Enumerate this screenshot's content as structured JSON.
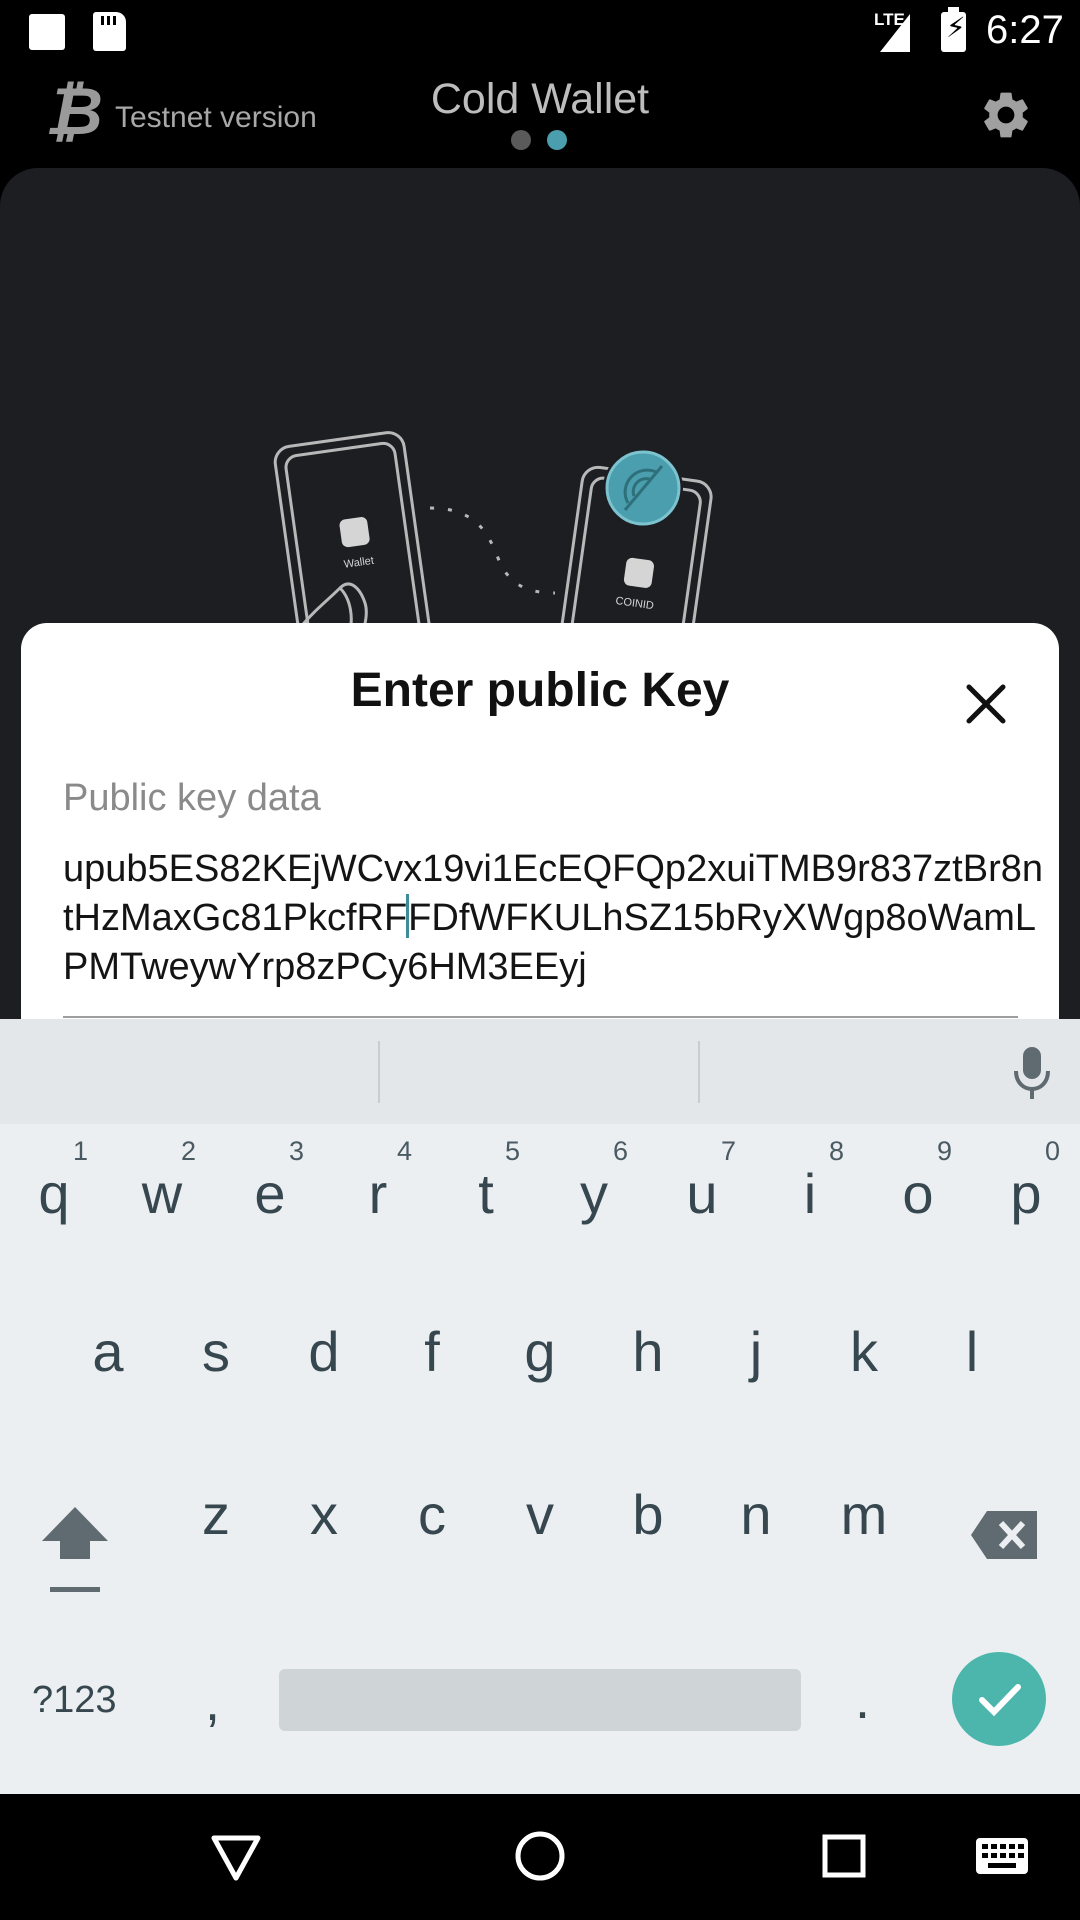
{
  "status_bar": {
    "network": "LTE",
    "time": "6:27"
  },
  "app_bar": {
    "logo_icon": "bitcoin-icon",
    "subtitle": "Testnet version",
    "title": "Cold Wallet",
    "page_indicator": {
      "count": 2,
      "active": 2
    },
    "settings_icon": "gear-icon"
  },
  "illustration": {
    "left_phone_label": "Wallet",
    "right_phone_label": "COINID"
  },
  "dialog": {
    "title": "Enter public Key",
    "field_label": "Public key data",
    "value_before_cursor": "upub5ES82KEjWCvx19vi1EcEQFQp2xuiTMB9r837ztBr8ntHzMaxGc81PkcfRF",
    "value_after_cursor": "FDfWFKULhSZ15bRyXWgp8oWamLPMTweywYrp8zPCy6HM3EEyj"
  },
  "keyboard": {
    "row1": [
      {
        "key": "q",
        "hint": "1"
      },
      {
        "key": "w",
        "hint": "2"
      },
      {
        "key": "e",
        "hint": "3"
      },
      {
        "key": "r",
        "hint": "4"
      },
      {
        "key": "t",
        "hint": "5"
      },
      {
        "key": "y",
        "hint": "6"
      },
      {
        "key": "u",
        "hint": "7"
      },
      {
        "key": "i",
        "hint": "8"
      },
      {
        "key": "o",
        "hint": "9"
      },
      {
        "key": "p",
        "hint": "0"
      }
    ],
    "row2": [
      "a",
      "s",
      "d",
      "f",
      "g",
      "h",
      "j",
      "k",
      "l"
    ],
    "row3": [
      "z",
      "x",
      "c",
      "v",
      "b",
      "n",
      "m"
    ],
    "symbols_label": "?123",
    "comma": ",",
    "period": "."
  },
  "colors": {
    "accent": "#4db6ac",
    "indicator_active": "#4a9eae",
    "indicator_inactive": "#5a5a5a",
    "dark_card": "#1d1e22"
  }
}
